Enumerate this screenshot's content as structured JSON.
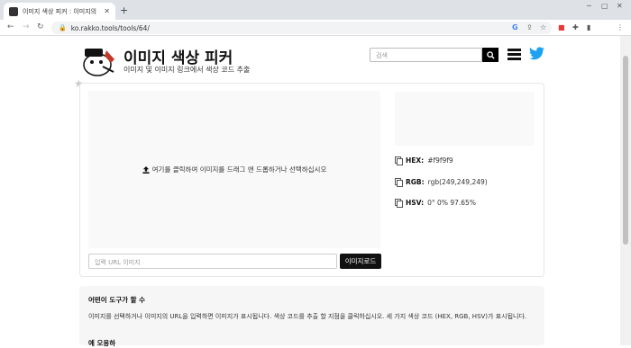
{
  "browser": {
    "tab_title": "이미지 색상 피커 : 이미지의 은...",
    "tab_close": "✕",
    "new_tab": "+",
    "url": "ko.rakko.tools/tools/64/"
  },
  "header": {
    "title": "이미지 색상 피커",
    "subtitle": "이미지 및 이미지 링크에서 색상 코드 추출",
    "search_placeholder": "검색"
  },
  "picker": {
    "dropzone_text": "여기를 클릭하여 이미지를 드래그 앤 드롭하거나 선택하십시오",
    "url_placeholder": "입력 URL 이미지",
    "load_button": "이미지로드",
    "swatch_color": "#f9f9f9",
    "hex_label": "HEX:",
    "hex_value": "#f9f9f9",
    "rgb_label": "RGB:",
    "rgb_value": "rgb(249,249,249)",
    "hsv_label": "HSV:",
    "hsv_value": "0° 0% 97.65%"
  },
  "howto": {
    "title": "어떤이 도구가 할 수",
    "body": "이미지를 선택하거나 이미지의 URL을 입력하면 이미지가 표시됩니다. 색상 코드를 추출 할 지점을 클릭하십시오. 세 가지 색상 코드 (HEX, RGB, HSV)가 표시됩니다.",
    "next_heading": "예 오용하"
  },
  "colors": {
    "twitter": "#1da1f2",
    "dark": "#111111"
  }
}
